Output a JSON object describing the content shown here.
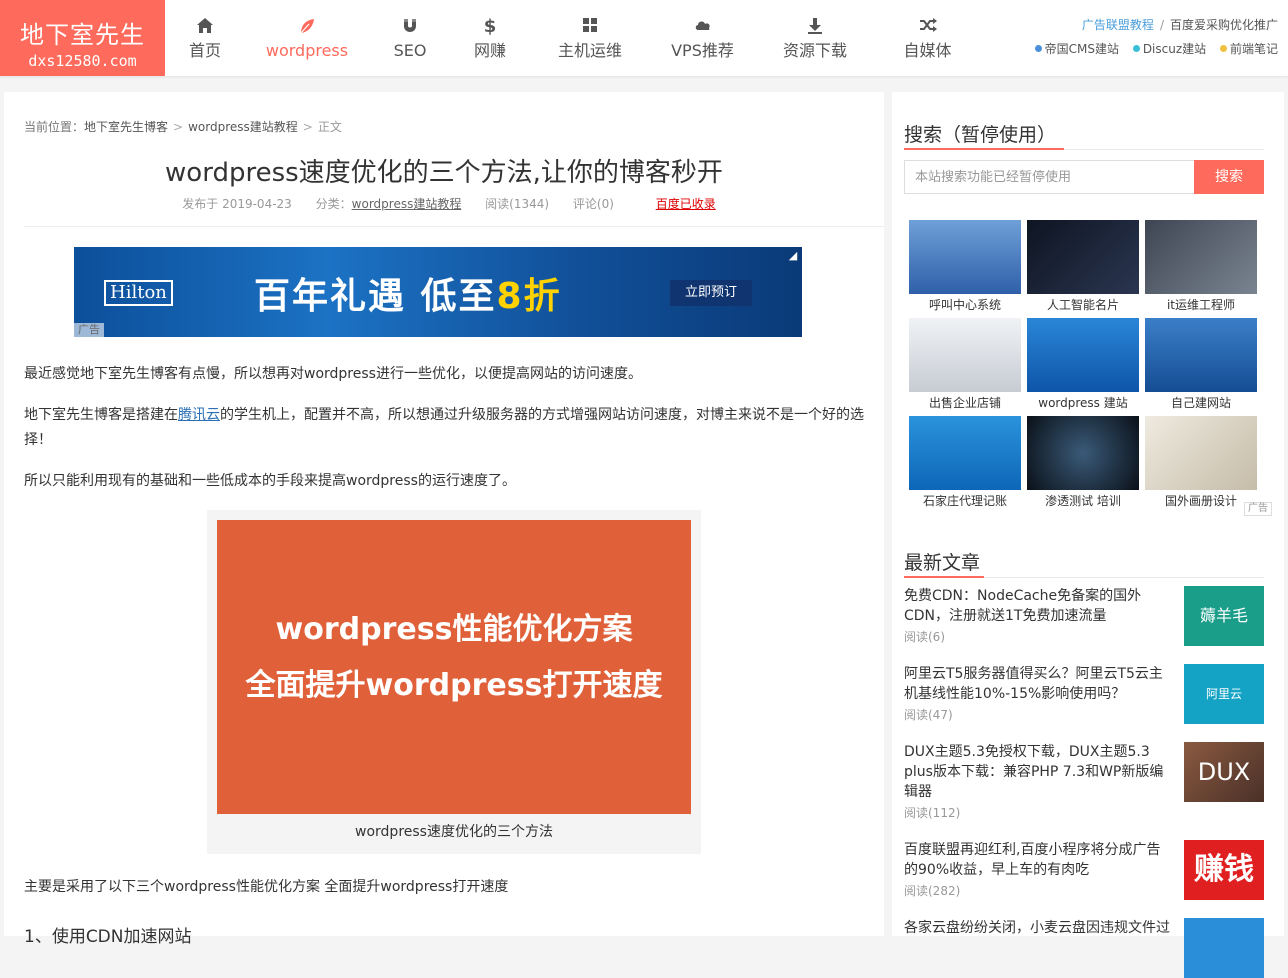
{
  "header": {
    "logo_title": "地下室先生",
    "logo_domain": "dxs12580.com",
    "nav": [
      {
        "label": "首页",
        "icon": "home-icon"
      },
      {
        "label": "wordpress",
        "icon": "leaf-icon",
        "active": true
      },
      {
        "label": "SEO",
        "icon": "magnet-icon"
      },
      {
        "label": "网赚",
        "icon": "dollar-icon"
      },
      {
        "label": "主机运维",
        "icon": "grid-icon"
      },
      {
        "label": "VPS推荐",
        "icon": "cloud-icon"
      },
      {
        "label": "资源下载",
        "icon": "download-icon"
      },
      {
        "label": "自媒体",
        "icon": "shuffle-icon"
      }
    ],
    "top_links": [
      "广告联盟教程",
      "百度爱采购优化推广"
    ],
    "tag_links": [
      {
        "label": "帝国CMS建站",
        "color": "#4a90d9"
      },
      {
        "label": "Discuz建站",
        "color": "#39c0d8"
      },
      {
        "label": "前端笔记",
        "color": "#f0c040"
      }
    ],
    "accent_color": "#fe6a5b"
  },
  "breadcrumb": {
    "prefix": "当前位置：",
    "home": "地下室先生博客",
    "category": "wordpress建站教程",
    "current": "正文",
    "separator": ">"
  },
  "article": {
    "title": "wordpress速度优化的三个方法,让你的博客秒开",
    "date": "发布于 2019-04-23",
    "category_prefix": "分类：",
    "category": "wordpress建站教程",
    "views": "阅读(1344)",
    "comments": "评论(0)",
    "baidu_status": "百度已收录",
    "ad_banner": {
      "brand": "Hilton",
      "slogan_a": "百年礼遇 低至",
      "slogan_b": "8折",
      "cta": "立即预订",
      "ad_tag": "广告"
    },
    "p1": "最近感觉地下室先生博客有点慢，所以想再对wordpress进行一些优化，以便提高网站的访问速度。",
    "p2_a": "地下室先生博客是搭建在",
    "p2_link": "腾讯云",
    "p2_b": "的学生机上，配置并不高，所以想通过升级服务器的方式增强网站访问速度，对博主来说不是一个好的选择！",
    "p3": "所以只能利用现有的基础和一些低成本的手段来提高wordpress的运行速度了。",
    "figure": {
      "line1": "wordpress性能优化方案",
      "line2": "全面提升wordpress打开速度",
      "caption": "wordpress速度优化的三个方法"
    },
    "p4": "主要是采用了以下三个wordpress性能优化方案 全面提升wordpress打开速度",
    "h1": "1、使用CDN加速网站"
  },
  "sidebar": {
    "search_title": "搜索（暂停使用）",
    "search_placeholder": "本站搜索功能已经暂停使用",
    "search_button": "搜索",
    "ads": [
      {
        "caption": "呼叫中心系统",
        "color": "#3a6fb8"
      },
      {
        "caption": "人工智能名片",
        "color": "#1a1f2b"
      },
      {
        "caption": "it运维工程师",
        "color": "#55606e"
      },
      {
        "caption": "出售企业店铺",
        "color": "#d8dde3"
      },
      {
        "caption": "wordpress 建站",
        "color": "#1a6ec2"
      },
      {
        "caption": "自己建网站",
        "color": "#1d5fae"
      },
      {
        "caption": "石家庄代理记账",
        "color": "#1578c8"
      },
      {
        "caption": "渗透测试 培训",
        "color": "#101820"
      },
      {
        "caption": "国外画册设计",
        "color": "#d9d2c2"
      }
    ],
    "ads_note": "广告",
    "latest_title": "最新文章",
    "posts": [
      {
        "title": "免费CDN：NodeCache免备案的国外CDN，注册就送1T免费加速流量",
        "views": "阅读(6)",
        "thumb_text": "薅羊毛",
        "thumb_color": "#1a9e8a"
      },
      {
        "title": "阿里云T5服务器值得买么？阿里云T5云主机基线性能10%-15%影响使用吗？",
        "views": "阅读(47)",
        "thumb_text": "阿里云",
        "thumb_color": "#14a3c4"
      },
      {
        "title": "DUX主题5.3免授权下载，DUX主题5.3 plus版本下载：兼容PHP 7.3和WP新版编辑器",
        "views": "阅读(112)",
        "thumb_text": "DUX",
        "thumb_color": "#6b4a3a"
      },
      {
        "title": "百度联盟再迎红利,百度小程序将分成广告的90%收益，早上车的有肉吃",
        "views": "阅读(282)",
        "thumb_text": "赚钱",
        "thumb_color": "#e02020"
      },
      {
        "title": "各家云盘纷纷关闭，小麦云盘因违规文件过",
        "views": "",
        "thumb_text": "",
        "thumb_color": "#2a8fd8"
      }
    ]
  }
}
